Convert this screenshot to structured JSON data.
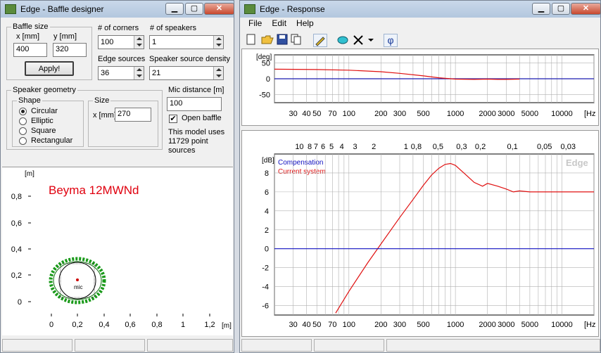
{
  "baffle_window": {
    "title": "Edge - Baffle designer",
    "baffle_size": {
      "label": "Baffle size",
      "x_label": "x [mm]",
      "y_label": "y [mm]",
      "x_value": "400",
      "y_value": "320",
      "apply_label": "Apply!"
    },
    "corners": {
      "label": "# of corners",
      "value": "100"
    },
    "speakers": {
      "label": "# of speakers",
      "value": "1"
    },
    "edge_sources": {
      "label": "Edge sources",
      "value": "36"
    },
    "speaker_density": {
      "label": "Speaker source density",
      "value": "21"
    },
    "geometry": {
      "label": "Speaker geometry",
      "shape_label": "Shape",
      "shapes": [
        "Circular",
        "Elliptic",
        "Square",
        "Rectangular"
      ],
      "selected": "Circular"
    },
    "size": {
      "label": "Size",
      "x_label": "x [mm]",
      "x_value": "270"
    },
    "mic_distance": {
      "label": "Mic distance [m]",
      "value": "100"
    },
    "open_baffle": {
      "label": "Open baffle",
      "checked": true
    },
    "model_info": [
      "This model uses",
      "11729 point",
      "sources"
    ],
    "plot": {
      "title": "Beyma 12MWNd",
      "y_unit": "[m]",
      "x_unit": "[m]",
      "y_ticks": [
        "0,8",
        "0,6",
        "0,4",
        "0,2",
        "0"
      ],
      "x_ticks": [
        "0",
        "0,2",
        "0,4",
        "0,6",
        "0,8",
        "1",
        "1,2"
      ],
      "mic_label": "mic"
    },
    "colors": {
      "title_text": "#e0000e",
      "baffle_edge": "#1a9a1a",
      "grid": "#000000"
    }
  },
  "response_window": {
    "title": "Edge - Response",
    "menu": [
      "File",
      "Edit",
      "Help"
    ],
    "phi_button": "φ",
    "phase_plot": {
      "unit": "[deg]",
      "y_ticks": [
        "50",
        "0",
        "-50"
      ],
      "x_ticks": [
        "30",
        "40",
        "50",
        "70",
        "100",
        "200",
        "300",
        "500",
        "1000",
        "2000",
        "3000",
        "5000",
        "10000"
      ],
      "x_unit": "[Hz"
    },
    "response_plot": {
      "unit": "[dB]",
      "legend": [
        "Compensation",
        "Current system"
      ],
      "watermark": "Edge",
      "top_ticks": [
        "10",
        "8",
        "7",
        "6",
        "5",
        "4",
        "3",
        "2",
        "1",
        "0,8",
        "0,5",
        "0,3",
        "0,2",
        "0,1",
        "0,05",
        "0,03"
      ],
      "y_ticks": [
        "8",
        "6",
        "4",
        "2",
        "0",
        "-2",
        "-4",
        "-6"
      ],
      "x_ticks": [
        "30",
        "40",
        "50",
        "70",
        "100",
        "200",
        "300",
        "500",
        "1000",
        "2000",
        "3000",
        "5000",
        "10000"
      ],
      "x_unit": "[Hz"
    },
    "colors": {
      "current": "#e01010",
      "compensation": "#1010c0",
      "zero": "#1c1cb0"
    }
  },
  "chart_data": [
    {
      "type": "line",
      "title": "",
      "xlabel": "[Hz",
      "ylabel": "[deg]",
      "xscale": "log",
      "xlim": [
        20,
        20000
      ],
      "ylim": [
        -75,
        75
      ],
      "series": [
        {
          "name": "",
          "x": [
            20,
            50,
            100,
            200,
            300,
            500,
            700,
            1000,
            1500,
            2000,
            2500,
            3000,
            4000
          ],
          "y": [
            30,
            29,
            27,
            22,
            17,
            9,
            3,
            -1,
            -2,
            -1,
            -2,
            -2,
            -1
          ]
        }
      ]
    },
    {
      "type": "line",
      "title": "",
      "xlabel": "[Hz",
      "ylabel": "[dB]",
      "xscale": "log",
      "xlim": [
        20,
        20000
      ],
      "ylim": [
        -7,
        10
      ],
      "series": [
        {
          "name": "Current system",
          "x": [
            75,
            100,
            150,
            200,
            300,
            400,
            500,
            600,
            700,
            800,
            900,
            1000,
            1200,
            1500,
            1800,
            2000,
            2500,
            3000,
            3500,
            4000,
            5000,
            7000,
            10000,
            15000,
            20000
          ],
          "y": [
            -6.8,
            -4.5,
            -1.5,
            0.5,
            3.3,
            5.2,
            6.7,
            7.8,
            8.5,
            8.9,
            9.0,
            8.8,
            8.0,
            7.0,
            6.6,
            6.9,
            6.6,
            6.3,
            6.0,
            6.1,
            6.0,
            6.0,
            6.0,
            6.0,
            6.0
          ]
        },
        {
          "name": "Compensation",
          "x": [
            20,
            20000
          ],
          "y": [
            0,
            0
          ]
        }
      ]
    }
  ]
}
